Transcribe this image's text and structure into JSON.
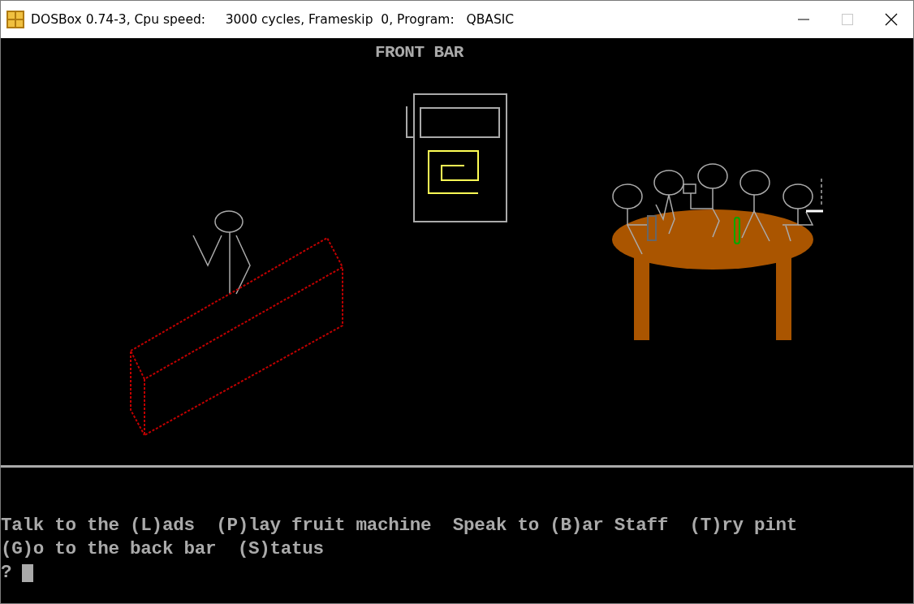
{
  "window": {
    "title": "DOSBox 0.74-3, Cpu speed:     3000 cycles, Frameskip  0, Program:   QBASIC",
    "controls": [
      {
        "kind": "minimize",
        "disabled": false
      },
      {
        "kind": "maximize",
        "disabled": true
      },
      {
        "kind": "close",
        "disabled": false
      }
    ]
  },
  "screen": {
    "heading": "FRONT BAR",
    "menu_lines": [
      "Talk to the (L)ads  (P)lay fruit machine  Speak to (B)ar Staff  (T)ry pint",
      "(G)o to the back bar  (S)tatus"
    ],
    "prompt": "?"
  }
}
